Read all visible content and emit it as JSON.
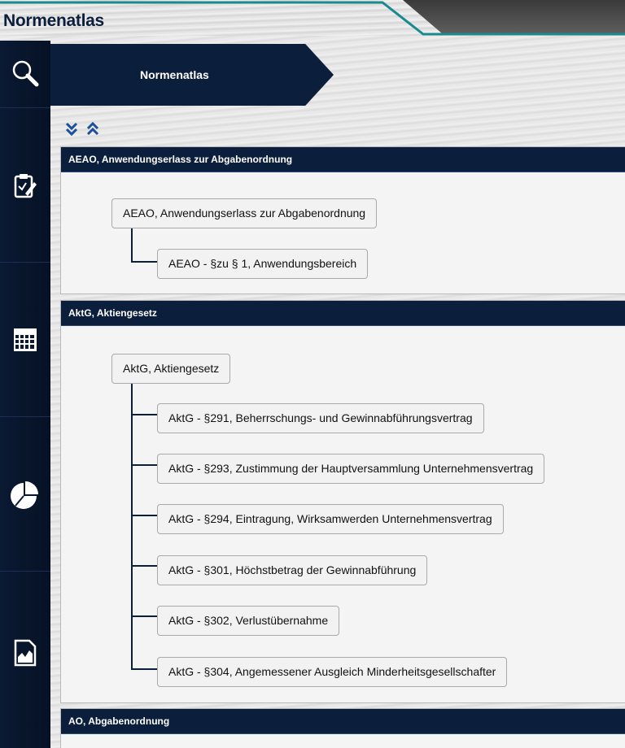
{
  "app": {
    "title": "Normenatlas"
  },
  "breadcrumb": {
    "label": "Normenatlas"
  },
  "toolbar": {
    "expand_icon": "double-chevron-down-icon",
    "collapse_icon": "double-chevron-up-icon"
  },
  "sidebar": {
    "items": [
      {
        "icon": "search-icon"
      },
      {
        "icon": "clipboard-edit-icon"
      },
      {
        "icon": "calendar-grid-icon"
      },
      {
        "icon": "pie-chart-icon"
      },
      {
        "icon": "report-chart-icon"
      }
    ]
  },
  "panels": [
    {
      "header": "AEAO, Anwendungserlass zur Abgabenordnung",
      "root": "AEAO, Anwendungserlass zur Abgabenordnung",
      "children": [
        "AEAO - §zu § 1, Anwendungsbereich"
      ]
    },
    {
      "header": "AktG, Aktiengesetz",
      "root": "AktG, Aktiengesetz",
      "children": [
        "AktG - §291, Beherrschungs- und Gewinnabführungsvertrag",
        "AktG - §293, Zustimmung der Hauptversammlung Unternehmensvertrag",
        "AktG - §294, Eintragung, Wirksamwerden Unternehmensvertrag",
        "AktG - §301, Höchstbetrag der Gewinnabführung",
        "AktG - §302, Verlustübernahme",
        "AktG - §304, Angemessener Ausgleich Minderheitsgesellschafter"
      ]
    },
    {
      "header": "AO, Abgabenordnung"
    }
  ],
  "colors": {
    "navy": "#0b1e3c",
    "teal": "#1a8a8f"
  }
}
